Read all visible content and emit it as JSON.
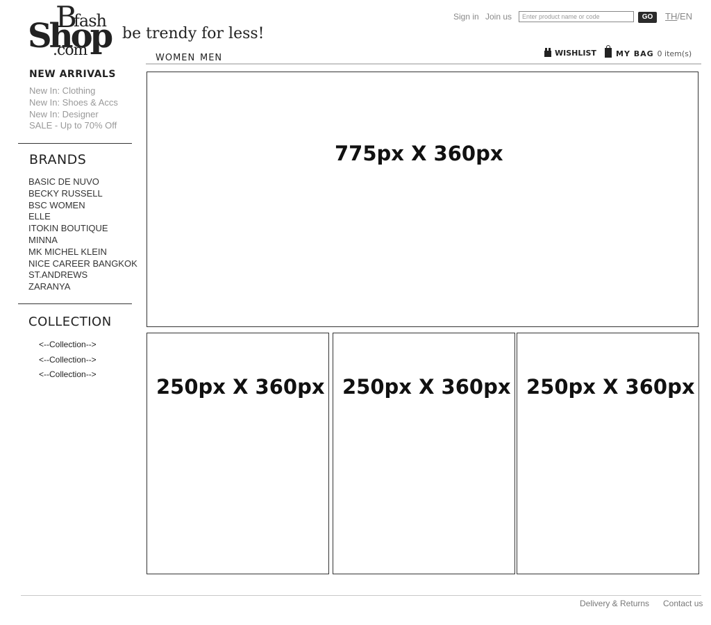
{
  "header": {
    "logo": {
      "b": "B",
      "fash": "fash",
      "shop": "Shop",
      "com": ".com"
    },
    "tagline": "be trendy for less!",
    "sign_in": "Sign in",
    "join_us": "Join us",
    "search_placeholder": "Enter product name or code",
    "go_label": "GO",
    "lang_th": "TH",
    "lang_sep": "/",
    "lang_en": "EN",
    "nav": {
      "women": "WOMEN",
      "men": "MEN"
    },
    "wishlist": "WISHLIST",
    "bag_label": "MY BAG",
    "bag_count": "0 item(s)"
  },
  "sidebar": {
    "new_arrivals": {
      "title": "NEW ARRIVALS",
      "items": [
        "New In: Clothing",
        "New In: Shoes & Accs",
        "New In: Designer",
        "SALE - Up to 70% Off"
      ]
    },
    "brands": {
      "title": "BRANDS",
      "items": [
        "BASIC DE NUVO",
        "BECKY RUSSELL",
        "BSC WOMEN",
        "ELLE",
        "ITOKIN BOUTIQUE",
        "MINNA",
        "MK MICHEL KLEIN",
        "NICE CAREER BANGKOK",
        "ST.ANDREWS",
        "ZARANYA"
      ]
    },
    "collection": {
      "title": "COLLECTION",
      "items": [
        "<--Collection-->",
        "<--Collection-->",
        "<--Collection-->"
      ]
    }
  },
  "main": {
    "hero_label": "775px X 360px",
    "tiles": [
      "250px X 360px",
      "250px X 360px",
      "250px X 360px"
    ]
  },
  "footer": {
    "delivery": "Delivery & Returns",
    "contact": "Contact us"
  }
}
